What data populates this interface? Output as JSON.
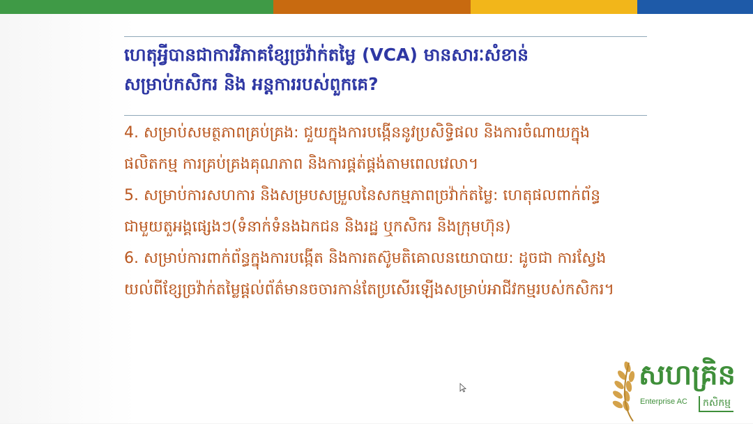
{
  "topbar": {
    "colors": [
      "#3f9a46",
      "#c86a10",
      "#f2b61a",
      "#1e5aa8"
    ]
  },
  "slide": {
    "title_lines": [
      "ហេតុអ្វីបានជាការវិភាគខ្សែច្រវ៉ាក់តម្លៃ (VCA) មានសារៈសំខាន់",
      "សម្រាប់កសិករ និង  អន្តការរបស់ពួកគេ?"
    ],
    "body_lines": [
      "4. សម្រាប់សមត្ថភាពគ្រប់គ្រង: ជួយក្នុងការបង្កើននូវប្រសិទ្ធិផល និងការចំណាយក្នុង",
      "ផលិតកម្ម ការគ្រប់គ្រងគុណភាព និងការផ្គត់ផ្គង់តាមពេលវេលា។",
      "5. សម្រាប់ការសហការ និងសម្របសម្រួលនៃសកម្មភាពច្រវ៉ាក់តម្លៃ: ហេតុផលពាក់ព័ន្ធ",
      "ជាមួយតួអង្គផ្សេងៗ(ទំនាក់ទំនងឯកជន និងរដ្ឋ ឬកសិករ និងក្រុមហ៊ុន)",
      "6. សម្រាប់ការពាក់ព័ន្ធក្នុងការបង្កើត និងការតស៊ូមតិគោលនយោបាយ: ដូចជា ការស្វែង",
      "យល់ពីខ្សែច្រវ៉ាក់តម្លៃផ្តល់ព័ត៌មានចចារកាន់តែប្រសើរឡើងសម្រាប់អាជីវកម្មរបស់កសិករ។"
    ],
    "title_color": "#2e37a3",
    "body_color": "#b9561e"
  },
  "logo": {
    "brand_khmer": "សហគ្រិន",
    "brand_en": "Enterprise AC",
    "sub_khmer": "កសិកម្ម",
    "icon": "wheat-icon",
    "color": "#3f8f3a"
  }
}
